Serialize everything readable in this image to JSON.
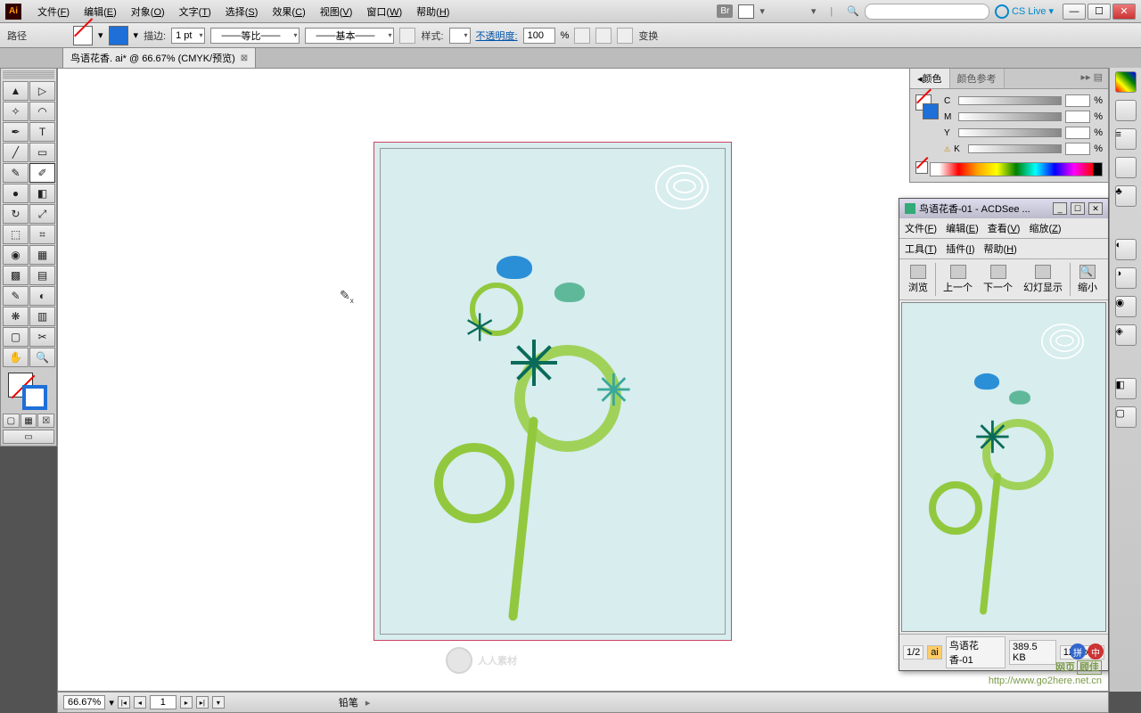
{
  "app": {
    "logo": "Ai"
  },
  "menu": {
    "items": [
      {
        "label": "文件",
        "key": "F"
      },
      {
        "label": "编辑",
        "key": "E"
      },
      {
        "label": "对象",
        "key": "O"
      },
      {
        "label": "文字",
        "key": "T"
      },
      {
        "label": "选择",
        "key": "S"
      },
      {
        "label": "效果",
        "key": "C"
      },
      {
        "label": "视图",
        "key": "V"
      },
      {
        "label": "窗口",
        "key": "W"
      },
      {
        "label": "帮助",
        "key": "H"
      }
    ],
    "br": "Br",
    "cslive": "CS Live"
  },
  "options": {
    "path_label": "路径",
    "stroke_label": "描边:",
    "stroke_pt": "1 pt",
    "profile": "等比",
    "brush": "基本",
    "style_label": "样式:",
    "opacity_label": "不透明度:",
    "opacity_val": "100",
    "opacity_pct": "%",
    "transform": "变换"
  },
  "doc_tab": {
    "title": "鸟语花香. ai* @ 66.67% (CMYK/预览)"
  },
  "color_panel": {
    "tab1": "颜色",
    "tab2": "颜色参考",
    "c": "C",
    "m": "M",
    "y": "Y",
    "k": "K",
    "pct": "%"
  },
  "acdsee": {
    "title": "鸟语花香-01 - ACDSee ...",
    "menu": [
      {
        "label": "文件",
        "key": "F"
      },
      {
        "label": "编辑",
        "key": "E"
      },
      {
        "label": "查看",
        "key": "V"
      },
      {
        "label": "缩放",
        "key": "Z"
      },
      {
        "label": "工具",
        "key": "T"
      },
      {
        "label": "插件",
        "key": "I"
      },
      {
        "label": "帮助",
        "key": "H"
      }
    ],
    "toolbar": {
      "browse": "浏览",
      "prev": "上一个",
      "next": "下一个",
      "slide": "幻灯显示",
      "zoomout": "缩小"
    },
    "status": {
      "page": "1/2",
      "name": "鸟语花香-01",
      "size": "389.5 KB",
      "dim": "1264x17"
    }
  },
  "statusbar": {
    "zoom": "66.67%",
    "page": "1",
    "tool": "铅笔"
  },
  "watermark": {
    "text": "人人素材",
    "brand": "网页",
    "sub": "顾佳",
    "url": "http://www.go2here.net.cn"
  },
  "lang": {
    "a": "拼",
    "b": "中"
  },
  "tools": {
    "row": [
      [
        "selection",
        "▲"
      ],
      [
        "direct-select",
        "▷"
      ],
      [
        "magic-wand",
        "✧"
      ],
      [
        "lasso",
        "◠"
      ],
      [
        "pen",
        "✒"
      ],
      [
        "type",
        "T"
      ],
      [
        "line",
        "╱"
      ],
      [
        "rectangle",
        "▭"
      ],
      [
        "paintbrush",
        "✎"
      ],
      [
        "pencil",
        "✐"
      ],
      [
        "blob",
        "●"
      ],
      [
        "eraser",
        "◧"
      ],
      [
        "rotate",
        "↻"
      ],
      [
        "scale",
        "⤢"
      ],
      [
        "warp",
        "⬚"
      ],
      [
        "free-transform",
        "⌗"
      ],
      [
        "shape-builder",
        "◉"
      ],
      [
        "perspective",
        "▦"
      ],
      [
        "mesh",
        "▩"
      ],
      [
        "gradient",
        "▤"
      ],
      [
        "eyedropper",
        "✎"
      ],
      [
        "blend",
        "◐"
      ],
      [
        "symbol-spray",
        "❋"
      ],
      [
        "graph",
        "▥"
      ],
      [
        "artboard",
        "▢"
      ],
      [
        "slice",
        "✂"
      ],
      [
        "hand",
        "✋"
      ],
      [
        "zoom",
        "🔍"
      ]
    ]
  }
}
